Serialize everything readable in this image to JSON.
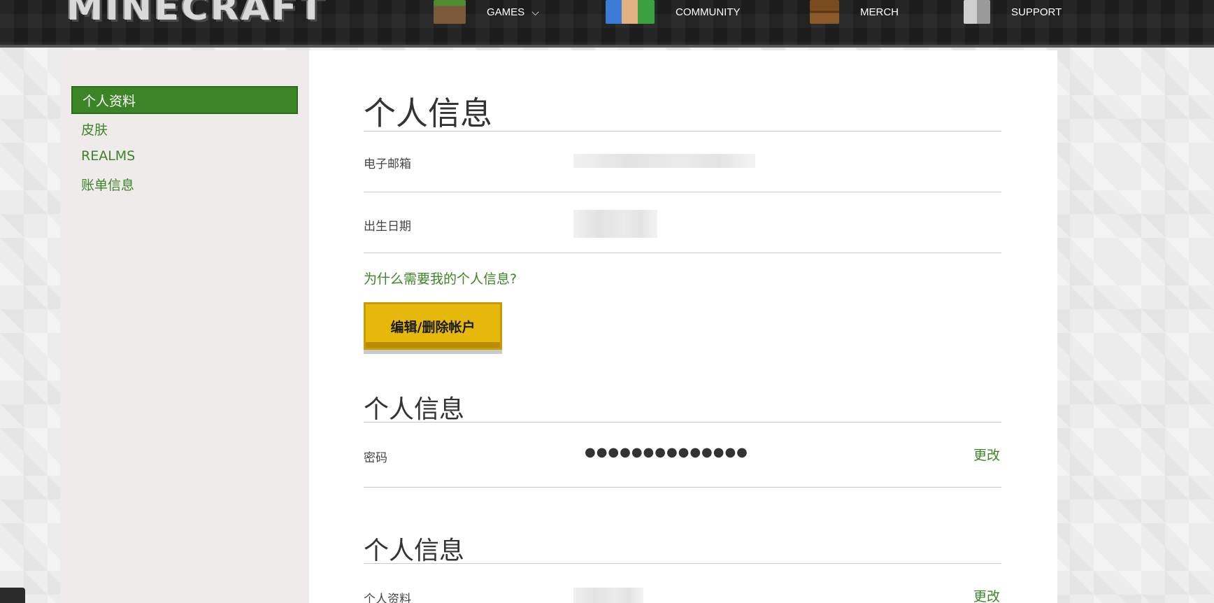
{
  "header": {
    "logo": "MINECRAFT",
    "nav": [
      {
        "label": "GAMES",
        "icon": "grass-block-icon",
        "has_dropdown": true
      },
      {
        "label": "COMMUNITY",
        "icon": "characters-icon"
      },
      {
        "label": "MERCH",
        "icon": "chest-icon"
      },
      {
        "label": "SUPPORT",
        "icon": "robot-icon"
      }
    ],
    "dropdown_glyph": "⌵"
  },
  "sidebar": {
    "items": [
      {
        "label": "个人资料",
        "active": true
      },
      {
        "label": "皮肤"
      },
      {
        "label": "REALMS"
      },
      {
        "label": "账单信息"
      }
    ]
  },
  "main": {
    "section1": {
      "title": "个人信息",
      "email_label": "电子邮箱",
      "birthdate_label": "出生日期",
      "why_link": "为什么需要我的个人信息?",
      "edit_button": "编辑/删除帐户"
    },
    "section2": {
      "title": "个人信息",
      "password_label": "密码",
      "password_value": "●●●●●●●●●●●●●●",
      "change_link": "更改"
    },
    "section3": {
      "title": "个人信息",
      "profile_label": "个人资料",
      "change_link": "更改"
    }
  },
  "colors": {
    "accent_green": "#3c8527",
    "button_yellow": "#e5b80b",
    "header_bg": "#1c1c1c"
  }
}
